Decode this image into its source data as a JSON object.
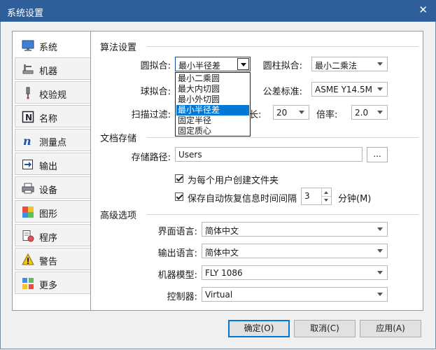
{
  "window": {
    "title": "系统设置",
    "close_glyph": "✕"
  },
  "sidebar": {
    "items": [
      {
        "label": "系统",
        "icon": "monitor-icon"
      },
      {
        "label": "机器",
        "icon": "machine-icon"
      },
      {
        "label": "校验规",
        "icon": "probe-icon"
      },
      {
        "label": "名称",
        "icon": "name-icon"
      },
      {
        "label": "测量点",
        "icon": "measure-point-icon"
      },
      {
        "label": "输出",
        "icon": "output-icon"
      },
      {
        "label": "设备",
        "icon": "printer-icon"
      },
      {
        "label": "图形",
        "icon": "graphics-icon"
      },
      {
        "label": "程序",
        "icon": "program-icon"
      },
      {
        "label": "警告",
        "icon": "warning-icon"
      },
      {
        "label": "更多",
        "icon": "more-icon"
      }
    ],
    "active_index": 0
  },
  "algo": {
    "title": "算法设置",
    "circle_fit_label": "圆拟合:",
    "circle_fit_value": "最小半径差",
    "cylinder_fit_label": "圆柱拟合:",
    "cylinder_fit_value": "最小二乘法",
    "sphere_fit_label": "球拟合:",
    "tolerance_std_label": "公差标准:",
    "tolerance_std_value": "ASME Y14.5M",
    "scan_filter_label": "扫描过滤:",
    "length_label_partial": "长:",
    "length_value": "20",
    "ratio_label": "倍率:",
    "ratio_value": "2.0"
  },
  "circle_fit_dropdown": {
    "options": [
      "最小二乘圆",
      "最大内切圆",
      "最小外切圆",
      "最小半径差",
      "固定半径",
      "固定质心"
    ],
    "selected_index": 3
  },
  "docs": {
    "title": "文档存储",
    "path_label": "存储路径:",
    "path_value": "Users",
    "browse_label": "...",
    "per_user_folder_label": "为每个用户创建文件夹",
    "per_user_folder_checked": true,
    "autosave_label": "保存自动恢复信息时间间隔",
    "autosave_checked": true,
    "autosave_interval": "3",
    "autosave_unit": "分钟(M)"
  },
  "advanced": {
    "title": "高级选项",
    "ui_lang_label": "界面语言:",
    "ui_lang_value": "简体中文",
    "out_lang_label": "输出语言:",
    "out_lang_value": "简体中文",
    "machine_model_label": "机器模型:",
    "machine_model_value": "FLY 1086",
    "controller_label": "控制器:",
    "controller_value": "Virtual"
  },
  "buttons": {
    "ok": "确定(O)",
    "cancel": "取消(C)",
    "apply": "应用(A)"
  },
  "colors": {
    "titlebar": "#2f5f9b",
    "selection": "#0078d7"
  }
}
